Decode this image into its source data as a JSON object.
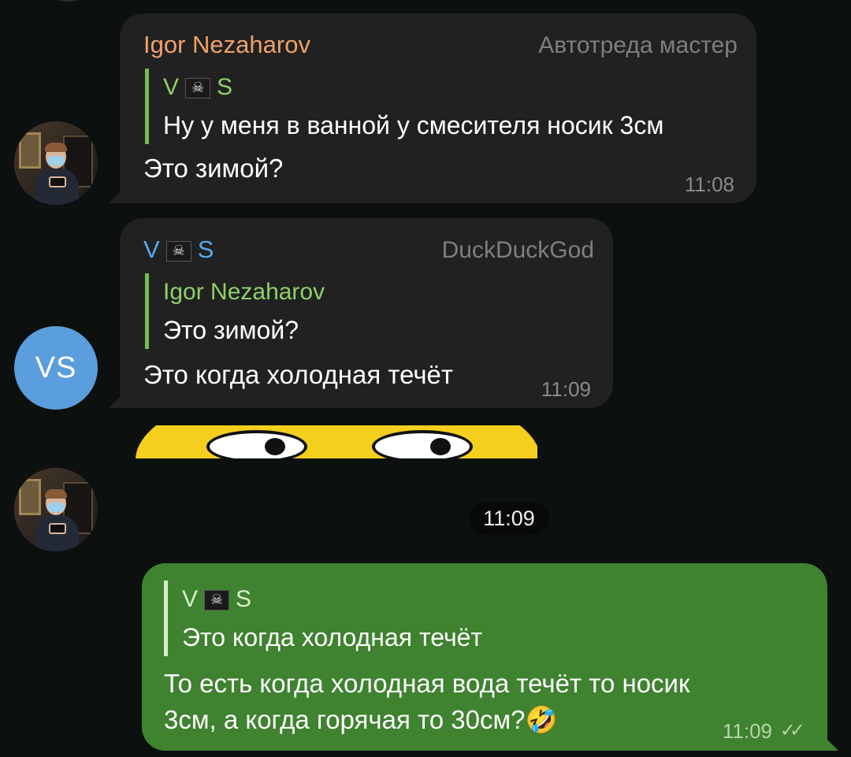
{
  "messages": [
    {
      "sender": "Igor Nezaharov",
      "sender_color": "#f0a06a",
      "role": "Автотреда мастер",
      "reply_author": "V S",
      "reply_author_color": "#8fd06a",
      "reply_text": "Ну у меня в ванной у смесителя носик 3см",
      "text": "Это зимой?",
      "time": "11:08"
    },
    {
      "sender": "V S",
      "sender_color": "#5aa8ec",
      "role": "DuckDuckGod",
      "reply_author": "Igor Nezaharov",
      "reply_author_color": "#8fd06a",
      "reply_text": "Это зимой?",
      "text": "Это когда холодная течёт",
      "time": "11:09"
    },
    {
      "sticker": "meme-face-sticker",
      "time": "11:09"
    },
    {
      "reply_author": "V S",
      "reply_text": "Это когда холодная течёт",
      "text_line1": "То есть когда холодная вода течёт то носик",
      "text_line2": "3см, а когда горячая то 30см?🤣",
      "time": "11:09",
      "status": "read"
    }
  ],
  "avatars": {
    "vs_initials": "VS",
    "vs_color": "#5a9ede"
  },
  "icons": {
    "pirate_flag": "☠",
    "read_checks": "✓✓"
  }
}
